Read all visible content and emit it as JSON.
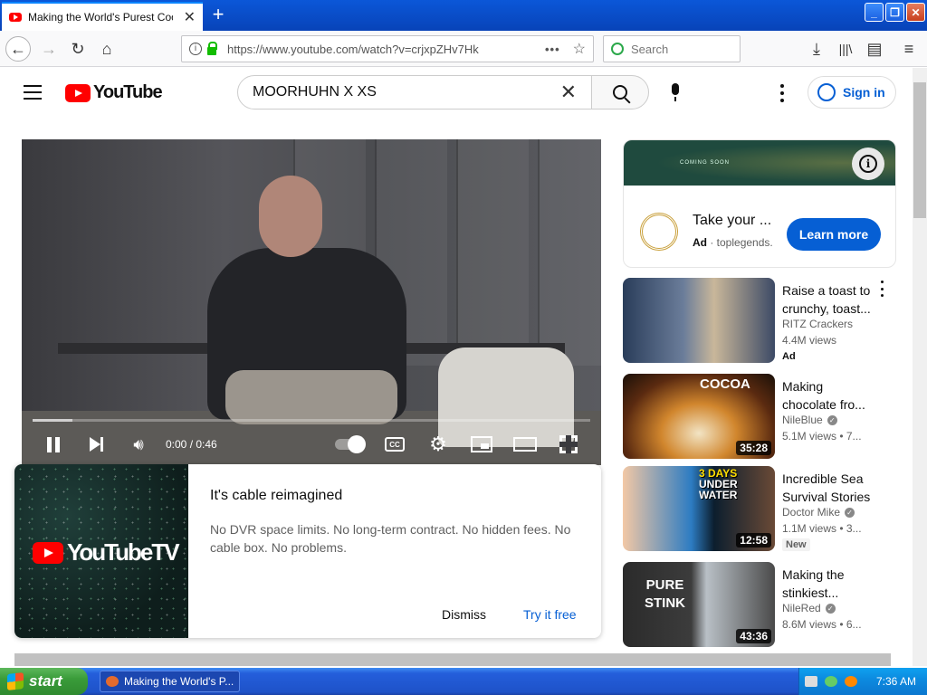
{
  "browser": {
    "tab_title": "Making the World's Purest Cookie",
    "url": "https://www.youtube.com/watch?v=crjxpZHv7Hk",
    "search_placeholder": "Search"
  },
  "youtube": {
    "logo_text": "YouTube",
    "search_query": "MOORHUHN X XS",
    "sign_in_label": "Sign in"
  },
  "player": {
    "time": "0:00 / 0:46",
    "progress": 0.0,
    "cc_label": "CC"
  },
  "promo": {
    "logo_text": "YouTubeTV",
    "title": "It's cable reimagined",
    "body": "No DVR space limits. No long-term contract. No hidden fees. No cable box. No problems.",
    "dismiss_label": "Dismiss",
    "try_label": "Try it free"
  },
  "ad": {
    "banner_text": "COMING SOON",
    "title": "Take your ...",
    "ad_label": "Ad",
    "domain": "toplegends.",
    "cta_label": "Learn more"
  },
  "recommendations": [
    {
      "title": "Raise a toast to crunchy, toast...",
      "channel": "RITZ Crackers",
      "views": "4.4M views",
      "badge": "Ad",
      "duration": ""
    },
    {
      "title": "Making chocolate fro...",
      "channel": "NileBlue",
      "views": "5.1M views • 7...",
      "badge": "",
      "duration": "35:28",
      "thumb_caption": "COCOA"
    },
    {
      "title": "Incredible Sea Survival Stories",
      "channel": "Doctor Mike",
      "views": "1.1M views • 3...",
      "badge": "New",
      "duration": "12:58",
      "thumb_caption_1": "3 DAYS",
      "thumb_caption_2": "UNDER",
      "thumb_caption_3": "WATER"
    },
    {
      "title": "Making the stinkiest...",
      "channel": "NileRed",
      "views": "8.6M views • 6...",
      "badge": "",
      "duration": "43:36",
      "thumb_caption_1": "PURE",
      "thumb_caption_2": "STINK"
    }
  ],
  "taskbar": {
    "start_label": "start",
    "task_title": "Making the World's P...",
    "clock": "7:36 AM"
  }
}
